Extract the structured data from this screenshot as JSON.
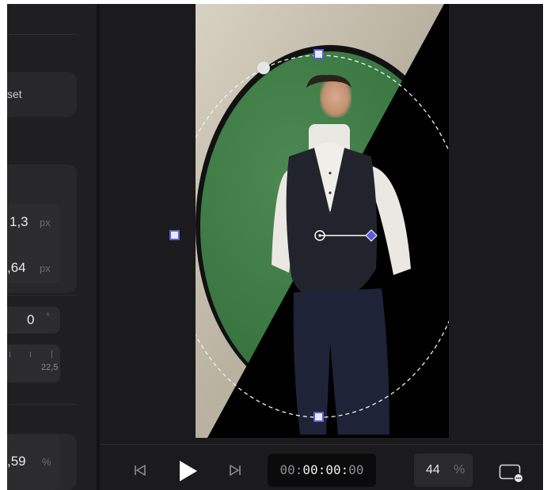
{
  "inspector": {
    "preset_label": "set",
    "position_x": "1,3",
    "position_y": ",64",
    "px_unit": "px",
    "rotation": "0",
    "degree_unit": "°",
    "ruler_value": "22,5",
    "opacity": ",59",
    "percent_unit": "%"
  },
  "playback": {
    "prev_icon": "skip-back-icon",
    "play_icon": "play-icon",
    "next_icon": "skip-forward-icon",
    "timecode_dim": "00:",
    "timecode_bright": "00:00:",
    "timecode_tail": "00",
    "zoom_value": "44",
    "zoom_unit": "%",
    "fit_icon": "fit-to-screen-icon"
  },
  "colors": {
    "handle_fill": "#e9e9ff",
    "handle_stroke": "#5b5bd6",
    "diamond": "#5b5bd6",
    "green_backdrop": "#3f7a45"
  }
}
